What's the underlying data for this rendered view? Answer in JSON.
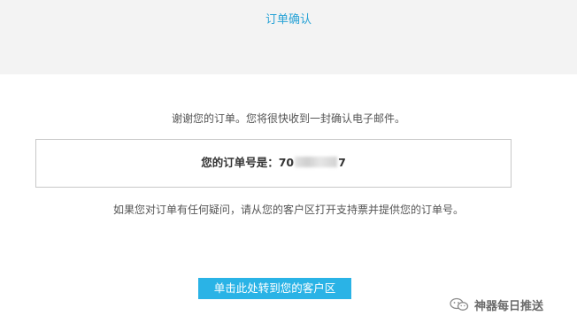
{
  "header": {
    "title": "订单确认"
  },
  "main": {
    "thanks_text": "谢谢您的订单。您将很快收到一封确认电子邮件。",
    "order_label": "您的订单号是：",
    "order_number_prefix": "70",
    "order_number_suffix": "7",
    "question_text": "如果您对订单有任何疑问，请从您的客户区打开支持票并提供您的订单号。",
    "client_area_button": "单击此处转到您的客户区"
  },
  "watermark": {
    "text": "神器每日推送",
    "icon": "wechat-icon"
  },
  "colors": {
    "accent": "#29a3d6",
    "button": "#2ab3e6",
    "header_bg": "#f3f3f3"
  }
}
